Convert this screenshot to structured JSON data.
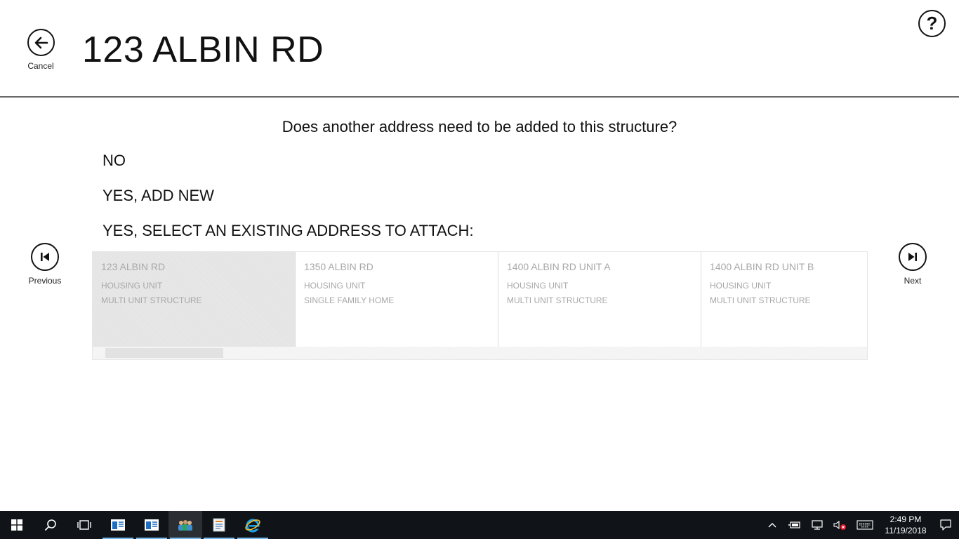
{
  "header": {
    "cancel_label": "Cancel",
    "title": "123 ALBIN RD",
    "help_symbol": "?"
  },
  "question": "Does another address need to be added to this structure?",
  "options": {
    "no": "NO",
    "yes_new": "YES, ADD NEW",
    "yes_existing": "YES, SELECT AN EXISTING ADDRESS TO ATTACH:"
  },
  "nav": {
    "previous_label": "Previous",
    "next_label": "Next"
  },
  "addresses": [
    {
      "name": "123 ALBIN RD",
      "type": "HOUSING UNIT",
      "structure": "MULTI UNIT STRUCTURE",
      "selected": true
    },
    {
      "name": "1350 ALBIN RD",
      "type": "HOUSING UNIT",
      "structure": "SINGLE FAMILY HOME",
      "selected": false
    },
    {
      "name": "1400 ALBIN RD UNIT A",
      "type": "HOUSING UNIT",
      "structure": "MULTI UNIT STRUCTURE",
      "selected": false
    },
    {
      "name": "1400 ALBIN RD UNIT B",
      "type": "HOUSING UNIT",
      "structure": "MULTI UNIT STRUCTURE",
      "selected": false
    }
  ],
  "taskbar": {
    "apps": [
      {
        "icon": "start-icon"
      },
      {
        "icon": "search-icon"
      },
      {
        "icon": "task-view-icon"
      },
      {
        "icon": "app-window-icon"
      },
      {
        "icon": "app-window-icon"
      },
      {
        "icon": "people-app-icon"
      },
      {
        "icon": "document-app-icon"
      },
      {
        "icon": "internet-explorer-icon"
      }
    ],
    "time": "2:49 PM",
    "date": "11/19/2018"
  },
  "colors": {
    "taskbar_bg": "#101418",
    "accent": "#76b9ed",
    "card_text": "#a8a8a8",
    "divider": "#6a6a6a"
  }
}
